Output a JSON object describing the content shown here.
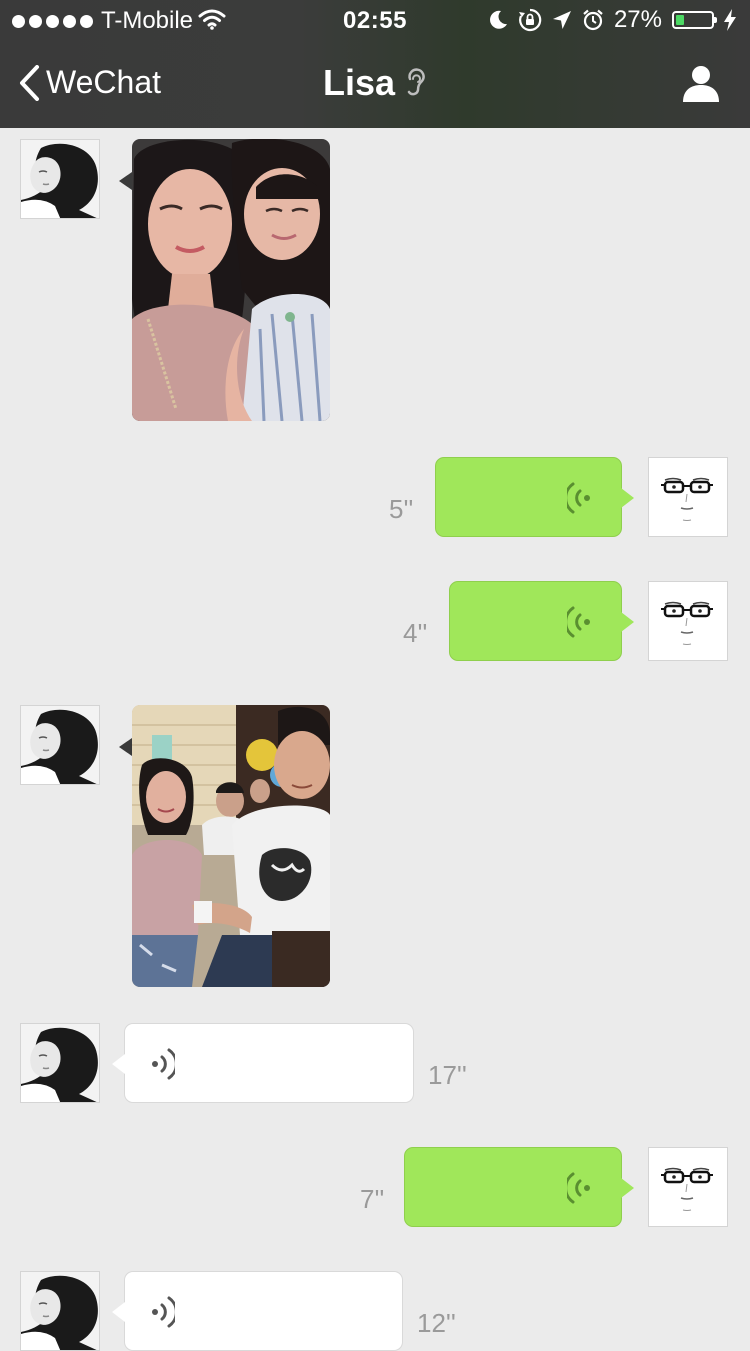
{
  "status_bar": {
    "carrier": "T-Mobile",
    "time": "02:55",
    "battery_percent": "27%",
    "battery_level": 0.27,
    "icons": [
      "signal-dots-icon",
      "wifi-icon",
      "moon-icon",
      "rotation-lock-icon",
      "location-icon",
      "alarm-icon",
      "battery-icon",
      "charging-icon"
    ]
  },
  "nav": {
    "back_label": "WeChat",
    "title": "Lisa",
    "title_icon": "earpiece-icon",
    "right_icon": "profile-icon"
  },
  "colors": {
    "nav_background": "#3a3a3a",
    "chat_background": "#ebebeb",
    "outgoing_bubble": "#a0e75a",
    "incoming_bubble": "#ffffff",
    "battery_fill": "#4cd964",
    "duration_text": "#9a9a9a"
  },
  "messages": [
    {
      "sender": "Lisa",
      "type": "photo",
      "content": "selfie of two girls"
    },
    {
      "sender": "me",
      "type": "voice",
      "duration": "5''"
    },
    {
      "sender": "me",
      "type": "voice",
      "duration": "4''"
    },
    {
      "sender": "Lisa",
      "type": "photo",
      "content": "group photo at a restaurant"
    },
    {
      "sender": "Lisa",
      "type": "voice",
      "duration": "17''"
    },
    {
      "sender": "me",
      "type": "voice",
      "duration": "7''"
    },
    {
      "sender": "Lisa",
      "type": "voice",
      "duration": "12''"
    }
  ]
}
